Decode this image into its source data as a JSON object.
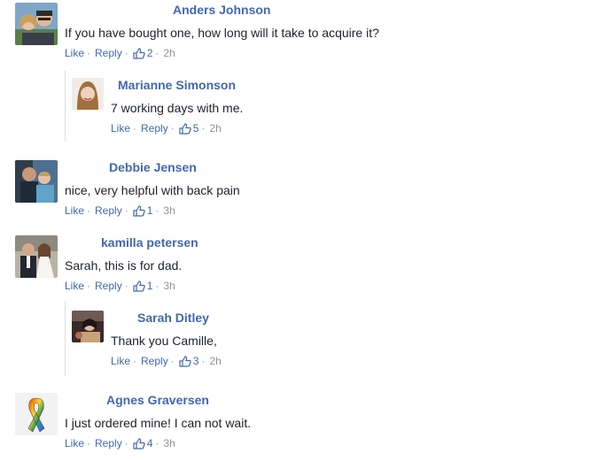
{
  "comments": [
    {
      "name": "Anders Johnson",
      "text": "If you have bought one, how long will it take to acquire it?",
      "like": "Like",
      "reply": "Reply",
      "likes": "2",
      "time": "2h",
      "avatar": "couple-photo"
    },
    {
      "name": "Marianne Simonson",
      "text": "7 working days with me.",
      "like": "Like",
      "reply": "Reply",
      "likes": "5",
      "time": "2h",
      "avatar": "woman-photo"
    },
    {
      "name": "Debbie Jensen",
      "text": "nice, very helpful with back pain",
      "like": "Like",
      "reply": "Reply",
      "likes": "1",
      "time": "3h",
      "avatar": "family-photo"
    },
    {
      "name": "kamilla petersen",
      "text": "Sarah, this is for dad.",
      "like": "Like",
      "reply": "Reply",
      "likes": "1",
      "time": "3h",
      "avatar": "wedding-photo"
    },
    {
      "name": "Sarah Ditley",
      "text": "Thank you Camille,",
      "like": "Like",
      "reply": "Reply",
      "likes": "3",
      "time": "2h",
      "avatar": "girl-photo"
    },
    {
      "name": "Agnes Graversen",
      "text": "I just ordered mine! I can not wait.",
      "like": "Like",
      "reply": "Reply",
      "likes": "4",
      "time": "3h",
      "avatar": "ribbon-image"
    }
  ],
  "colors": {
    "name": "#4267b2",
    "meta": "#90949c",
    "text": "#1d2129"
  }
}
